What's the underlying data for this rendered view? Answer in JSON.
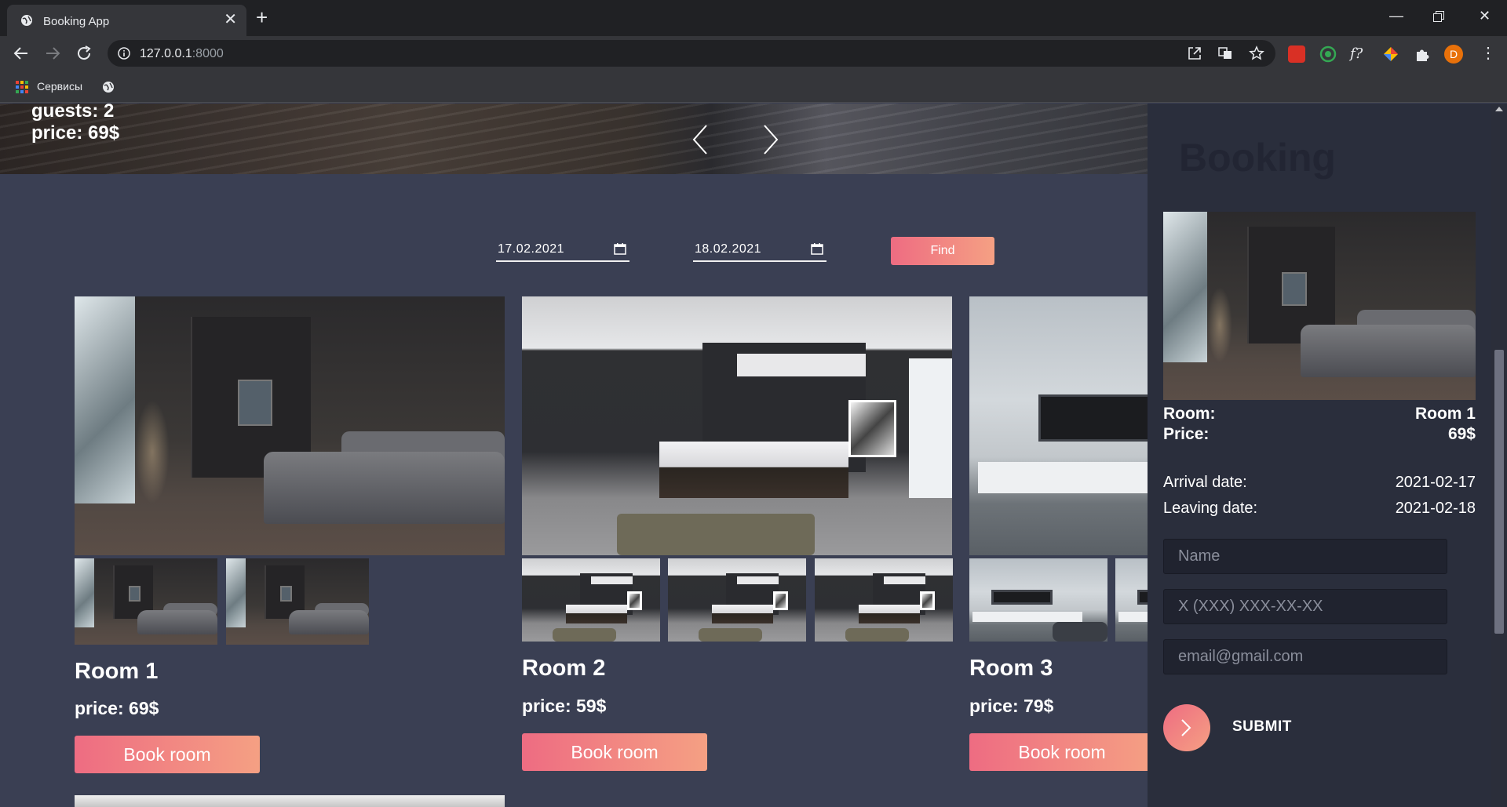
{
  "browser": {
    "tab_title": "Booking App",
    "url_host": "127.0.0.1",
    "url_port": ":8000",
    "bookmark_label": "Сервисы",
    "profile_initial": "D"
  },
  "hero": {
    "guests_text": "guests: 2",
    "price_text": "price: 69$"
  },
  "search": {
    "arrival": "17.02.2021",
    "leaving": "18.02.2021",
    "find_label": "Find"
  },
  "rooms": [
    {
      "title": "Room 1",
      "price": "price: 69$",
      "book_label": "Book room"
    },
    {
      "title": "Room 2",
      "price": "price: 59$",
      "book_label": "Book room"
    },
    {
      "title": "Room 3",
      "price": "price: 79$",
      "book_label": "Book room"
    }
  ],
  "booking": {
    "heading": "Booking",
    "room_label": "Room:",
    "room_value": "Room 1",
    "price_label": "Price:",
    "price_value": "69$",
    "arrival_label": "Arrival date:",
    "arrival_value": "2021-02-17",
    "leaving_label": "Leaving date:",
    "leaving_value": "2021-02-18",
    "name_placeholder": "Name",
    "phone_placeholder": "X (XXX) XXX-XX-XX",
    "email_placeholder": "email@gmail.com",
    "submit_label": "SUBMIT"
  },
  "colors": {
    "page_bg": "#3a3f53",
    "panel_bg": "#2a2e3c",
    "accent_start": "#ee6c82",
    "accent_end": "#f5a083"
  }
}
